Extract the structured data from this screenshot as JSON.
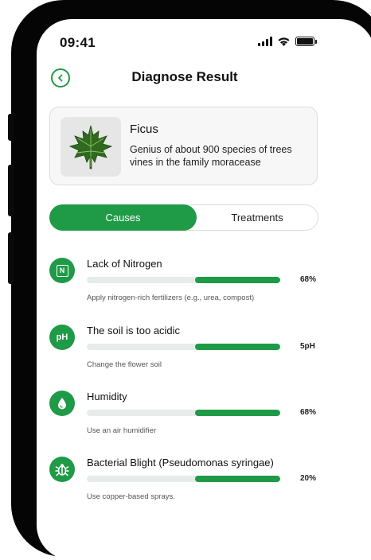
{
  "status_bar": {
    "time": "09:41"
  },
  "header": {
    "title": "Diagnose Result"
  },
  "plant": {
    "name": "Ficus",
    "description": "Genius of about 900 species of trees vines in the family moracease"
  },
  "tabs": [
    {
      "label": "Causes",
      "active": true
    },
    {
      "label": "Treatments",
      "active": false
    }
  ],
  "causes": [
    {
      "title": "Lack of Nitrogen",
      "value": "68%",
      "icon": "nitrogen-icon",
      "icon_text": "N",
      "tip": "Apply nitrogen-rich fertilizers (e.g., urea, compost)"
    },
    {
      "title": "The soil is too acidic",
      "value": "5pH",
      "icon": "ph-icon",
      "icon_text": "pH",
      "tip": "Change the flower soil"
    },
    {
      "title": "Humidity",
      "value": "68%",
      "icon": "water-drop-icon",
      "tip": "Use an air humidifier"
    },
    {
      "title": "Bacterial Blight (Pseudomonas syringae)",
      "value": "20%",
      "icon": "bug-icon",
      "tip": "Use copper-based sprays."
    }
  ],
  "colors": {
    "accent": "#1f9a47",
    "track": "#e6ecea"
  }
}
